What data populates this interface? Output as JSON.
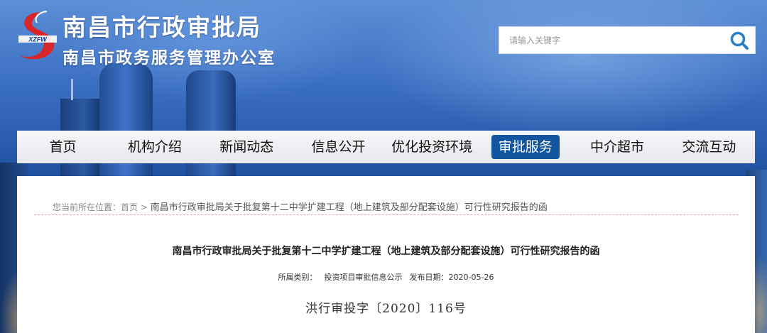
{
  "header": {
    "title": "南昌市行政审批局",
    "subtitle": "南昌市政务服务管理办公室",
    "logo_text": "XZFW"
  },
  "search": {
    "placeholder": "请输入关键字",
    "icon": "search-icon"
  },
  "nav": {
    "items": [
      {
        "label": "首页"
      },
      {
        "label": "机构介绍"
      },
      {
        "label": "新闻动态"
      },
      {
        "label": "信息公开"
      },
      {
        "label": "优化投资环境"
      },
      {
        "label": "审批服务",
        "active": true
      },
      {
        "label": "中介超市"
      },
      {
        "label": "交流互动"
      }
    ],
    "active_color": "#11559f"
  },
  "breadcrumb": {
    "prefix": "您当前所在位置：",
    "home": "首页",
    "separator": ">",
    "current": "南昌市行政审批局关于批复第十二中学扩建工程（地上建筑及部分配套设施）可行性研究报告的函"
  },
  "article": {
    "title": "南昌市行政审批局关于批复第十二中学扩建工程（地上建筑及部分配套设施）可行性研究报告的函",
    "category_label": "所属类别：",
    "category": "投资项目审批信息公示",
    "date_label": "发布日期：",
    "date": "2020-05-26",
    "doc_number": "洪行审投字〔2020〕116号"
  },
  "colors": {
    "logo_red": "#d8262b",
    "search_icon": "#2b7fc4"
  }
}
